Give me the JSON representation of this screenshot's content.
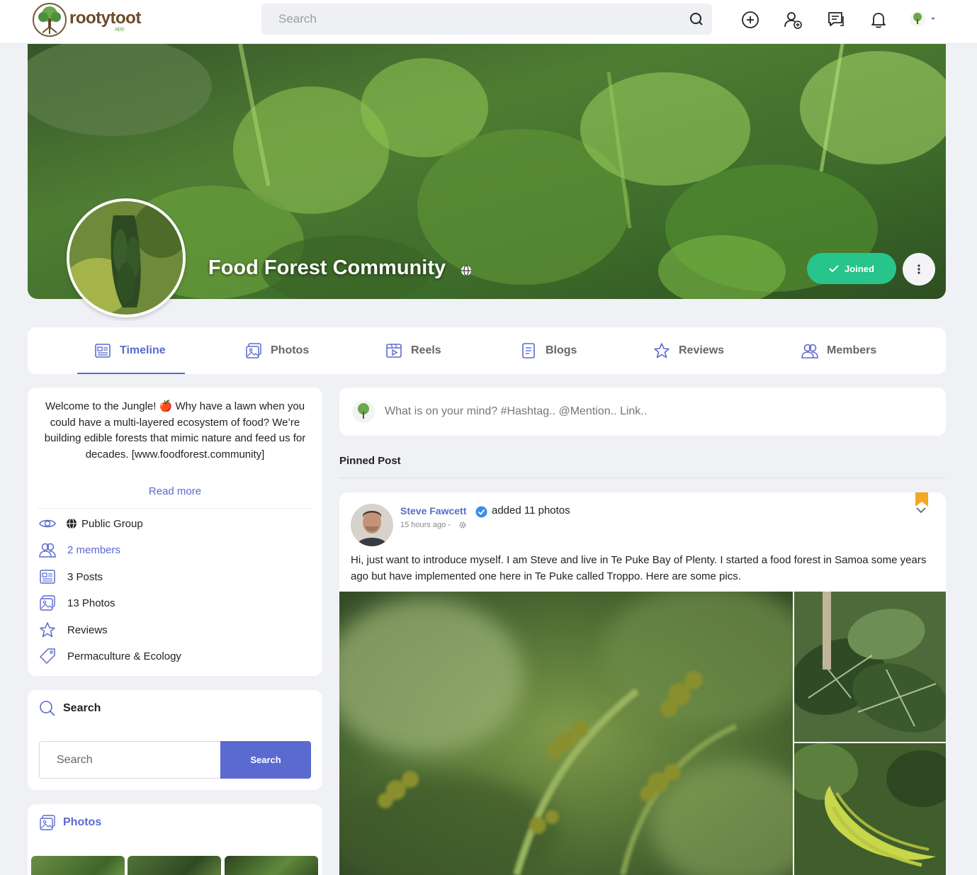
{
  "header": {
    "brand": "rootytoot",
    "brand_sub": ".app",
    "search_placeholder": "Search"
  },
  "group": {
    "title": "Food Forest Community",
    "joined_label": "Joined"
  },
  "tabs": [
    {
      "label": "Timeline",
      "icon": "newspaper-icon",
      "active": true
    },
    {
      "label": "Photos",
      "icon": "image-icon"
    },
    {
      "label": "Reels",
      "icon": "video-icon"
    },
    {
      "label": "Blogs",
      "icon": "document-icon"
    },
    {
      "label": "Reviews",
      "icon": "star-icon"
    },
    {
      "label": "Members",
      "icon": "users-icon"
    }
  ],
  "about": {
    "description": "Welcome to the Jungle! 🍎 Why have a lawn when you could have a multi-layered ecosystem of food? We’re building edible forests that mimic nature and feed us for decades. [www.foodforest.community]",
    "read_more": "Read more",
    "rows": [
      {
        "label": "Public Group",
        "icon": "eye-icon"
      },
      {
        "label": "2 members",
        "icon": "users-icon"
      },
      {
        "label": "3 Posts",
        "icon": "newspaper-icon"
      },
      {
        "label": "13 Photos",
        "icon": "image-icon"
      },
      {
        "label": "Reviews",
        "icon": "star-icon"
      },
      {
        "label": "Permaculture & Ecology",
        "icon": "tag-icon"
      }
    ]
  },
  "search_widget": {
    "title": "Search",
    "placeholder": "Search",
    "button": "Search"
  },
  "photos_widget": {
    "title": "Photos"
  },
  "composer": {
    "placeholder": "What is on your mind? #Hashtag.. @Mention.. Link.."
  },
  "pinned": {
    "label": "Pinned Post"
  },
  "post": {
    "author": "Steve Fawcett",
    "action": "added 11 photos",
    "time": "15 hours ago -",
    "body": "Hi, just want to introduce myself. I am Steve and live in Te Puke Bay of Plenty. I started a food forest in Samoa some years ago but have implemented one here in Te Puke called Troppo. Here are some pics."
  },
  "colors": {
    "accent": "#5b6ad0",
    "joined": "#27c48b",
    "bookmark": "#f5a623",
    "brand": "#6b4a2b"
  }
}
